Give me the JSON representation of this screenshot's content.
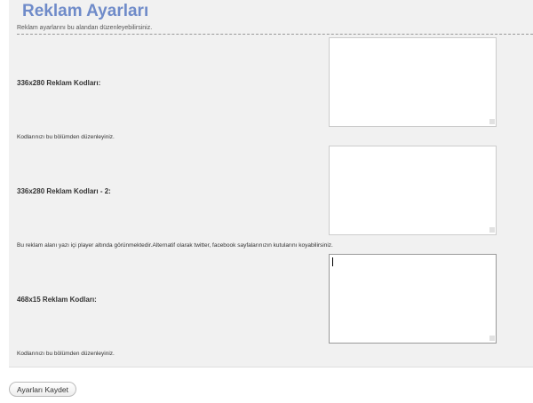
{
  "header": {
    "title": "Reklam Ayarları",
    "subtitle": "Reklam ayarlarını bu alandan düzenleyebilirsiniz."
  },
  "rows": [
    {
      "label": "336x280 Reklam Kodları:",
      "description": "Kodlarınızı bu bölümden düzenleyiniz.",
      "value": ""
    },
    {
      "label": "336x280 Reklam Kodları - 2:",
      "description": "Bu reklam alanı yazı içi player altında görünmektedir.Alternatif olarak twitter, facebook sayfalarınızın kutularını koyabilirsiniz.",
      "value": ""
    },
    {
      "label": "468x15 Reklam Kodları:",
      "description": "Kodlarınızı bu bölümden düzenleyiniz.",
      "value": ""
    }
  ],
  "actions": {
    "save_label": "Ayarları Kaydet"
  },
  "colors": {
    "title": "#6f8bc9",
    "panel_background": "#f1f1f1"
  }
}
